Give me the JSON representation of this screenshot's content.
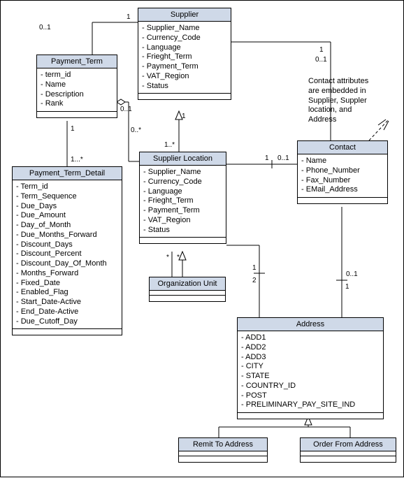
{
  "classes": {
    "supplier": {
      "title": "Supplier",
      "attrs": [
        "Supplier_Name",
        "Currency_Code",
        "Language",
        "Frieght_Term",
        "Payment_Term",
        "VAT_Region",
        "Status"
      ]
    },
    "payment_term": {
      "title": "Payment_Term",
      "attrs": [
        "term_id",
        "Name",
        "Description",
        "Rank"
      ]
    },
    "payment_term_detail": {
      "title": "Payment_Term_Detail",
      "attrs": [
        "Term_id",
        "Term_Sequence",
        "Due_Days",
        "Due_Amount",
        "Day_of_Month",
        "Due_Months_Forward",
        "Discount_Days",
        "Discount_Percent",
        "Discount_Day_Of_Month",
        "Months_Forward",
        "Fixed_Date",
        "Enabled_Flag",
        "Start_Date-Active",
        "End_Date-Active",
        "Due_Cutoff_Day"
      ]
    },
    "supplier_location": {
      "title": "Supplier Location",
      "attrs": [
        "Supplier_Name",
        "Currency_Code",
        "Language",
        "Frieght_Term",
        "Payment_Term",
        "VAT_Region",
        "Status"
      ]
    },
    "contact": {
      "title": "Contact",
      "attrs": [
        "Name",
        "Phone_Number",
        "Fax_Number",
        "EMail_Address"
      ]
    },
    "org_unit": {
      "title": "Organization Unit",
      "attrs": []
    },
    "address": {
      "title": "Address",
      "attrs": [
        "ADD1",
        "ADD2",
        "ADD3",
        "CITY",
        "STATE",
        "COUNTRY_ID",
        "POST",
        "PRELIMINARY_PAY_SITE_IND"
      ]
    },
    "remit_to": {
      "title": "Remit To Address",
      "attrs": []
    },
    "order_from": {
      "title": "Order From Address",
      "attrs": []
    }
  },
  "note": {
    "l1": "Contact attributes",
    "l2": "are embedded in",
    "l3": "Supplier, Suppler",
    "l4": "location, and",
    "l5": "Address"
  },
  "mult": {
    "sup_pt_sup": "1",
    "sup_pt_pt": "0..1",
    "pt_ptd_pt": "1",
    "pt_ptd_ptd": "1...*",
    "sup_sl_sup": "1",
    "sup_sl_sl": "1..*",
    "sl_pt_sl": "0..*",
    "sl_pt_pt": "0..1",
    "sl_org_sl": "*",
    "sl_org_org": "*",
    "sup_c_sup": "1",
    "sup_c_c": "0..1",
    "sl_c_sl": "1",
    "sl_c_c": "0..1",
    "sl_a_sl": "1",
    "sl_a_a": "2",
    "c_a_c": "0..1",
    "c_a_a": "1"
  }
}
